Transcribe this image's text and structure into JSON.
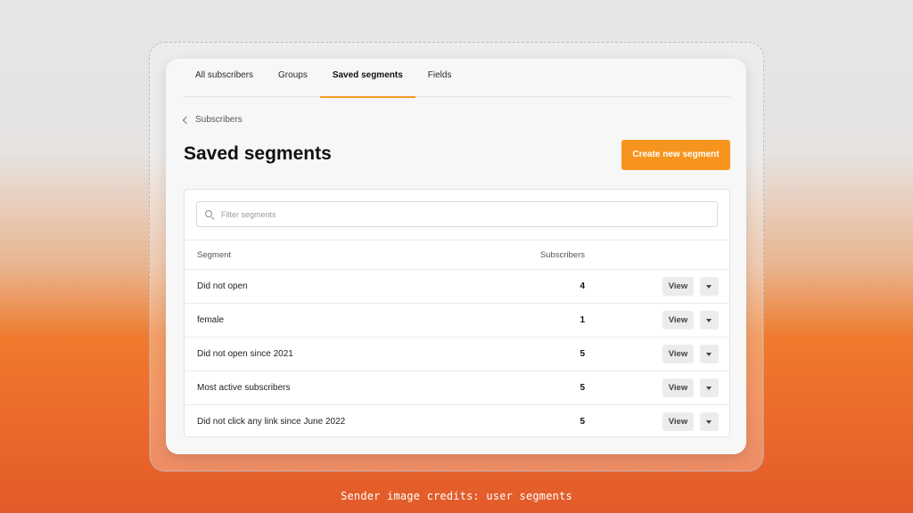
{
  "tabs": [
    {
      "label": "All subscribers",
      "active": false
    },
    {
      "label": "Groups",
      "active": false
    },
    {
      "label": "Saved segments",
      "active": true
    },
    {
      "label": "Fields",
      "active": false
    }
  ],
  "breadcrumb": {
    "label": "Subscribers"
  },
  "page": {
    "title": "Saved segments"
  },
  "actions": {
    "create_label": "Create new segment"
  },
  "search": {
    "placeholder": "Filter segments",
    "value": ""
  },
  "table": {
    "columns": {
      "segment": "Segment",
      "subscribers": "Subscribers"
    },
    "view_label": "View",
    "rows": [
      {
        "name": "Did not open",
        "count": "4"
      },
      {
        "name": "female",
        "count": "1"
      },
      {
        "name": "Did not open since 2021",
        "count": "5"
      },
      {
        "name": "Most active subscribers",
        "count": "5"
      },
      {
        "name": "Did not click any link since June 2022",
        "count": "5"
      }
    ]
  },
  "caption": "Sender image credits: user segments",
  "colors": {
    "accent": "#f7941d",
    "tab_underline": "#f59a23"
  },
  "icons": {
    "search": "search-icon",
    "back": "chevron-left-icon",
    "row_menu": "caret-down-icon"
  }
}
